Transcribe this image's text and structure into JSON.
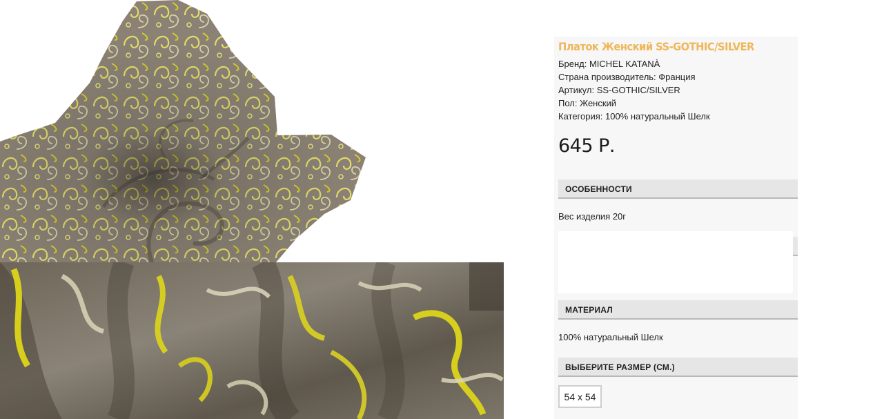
{
  "product": {
    "title": "Платок Женский SS-GOTHIC/SILVER",
    "specs": [
      "Бренд: MICHEL KATANÀ",
      "Страна производитель: Франция",
      "Артикул: SS-GOTHIC/SILVER",
      "Пол: Женский",
      "Категория: 100% натуральный Шелк"
    ],
    "price": "645 Р."
  },
  "features": {
    "heading": "ОСОБЕННОСТИ",
    "text": "Вес изделия 20г"
  },
  "material": {
    "heading": "МАТЕРИАЛ",
    "text": "100% натуральный Шелк"
  },
  "size": {
    "heading": "ВЫБЕРИТЕ РАЗМЕР (СМ.)",
    "selected": "54 х 54"
  },
  "colors": {
    "accent_title": "#f0b65a",
    "scarf_base": "#8a8175",
    "scarf_pattern_yellow": "#d9cf2e",
    "scarf_pattern_light": "#d8d4b4"
  }
}
